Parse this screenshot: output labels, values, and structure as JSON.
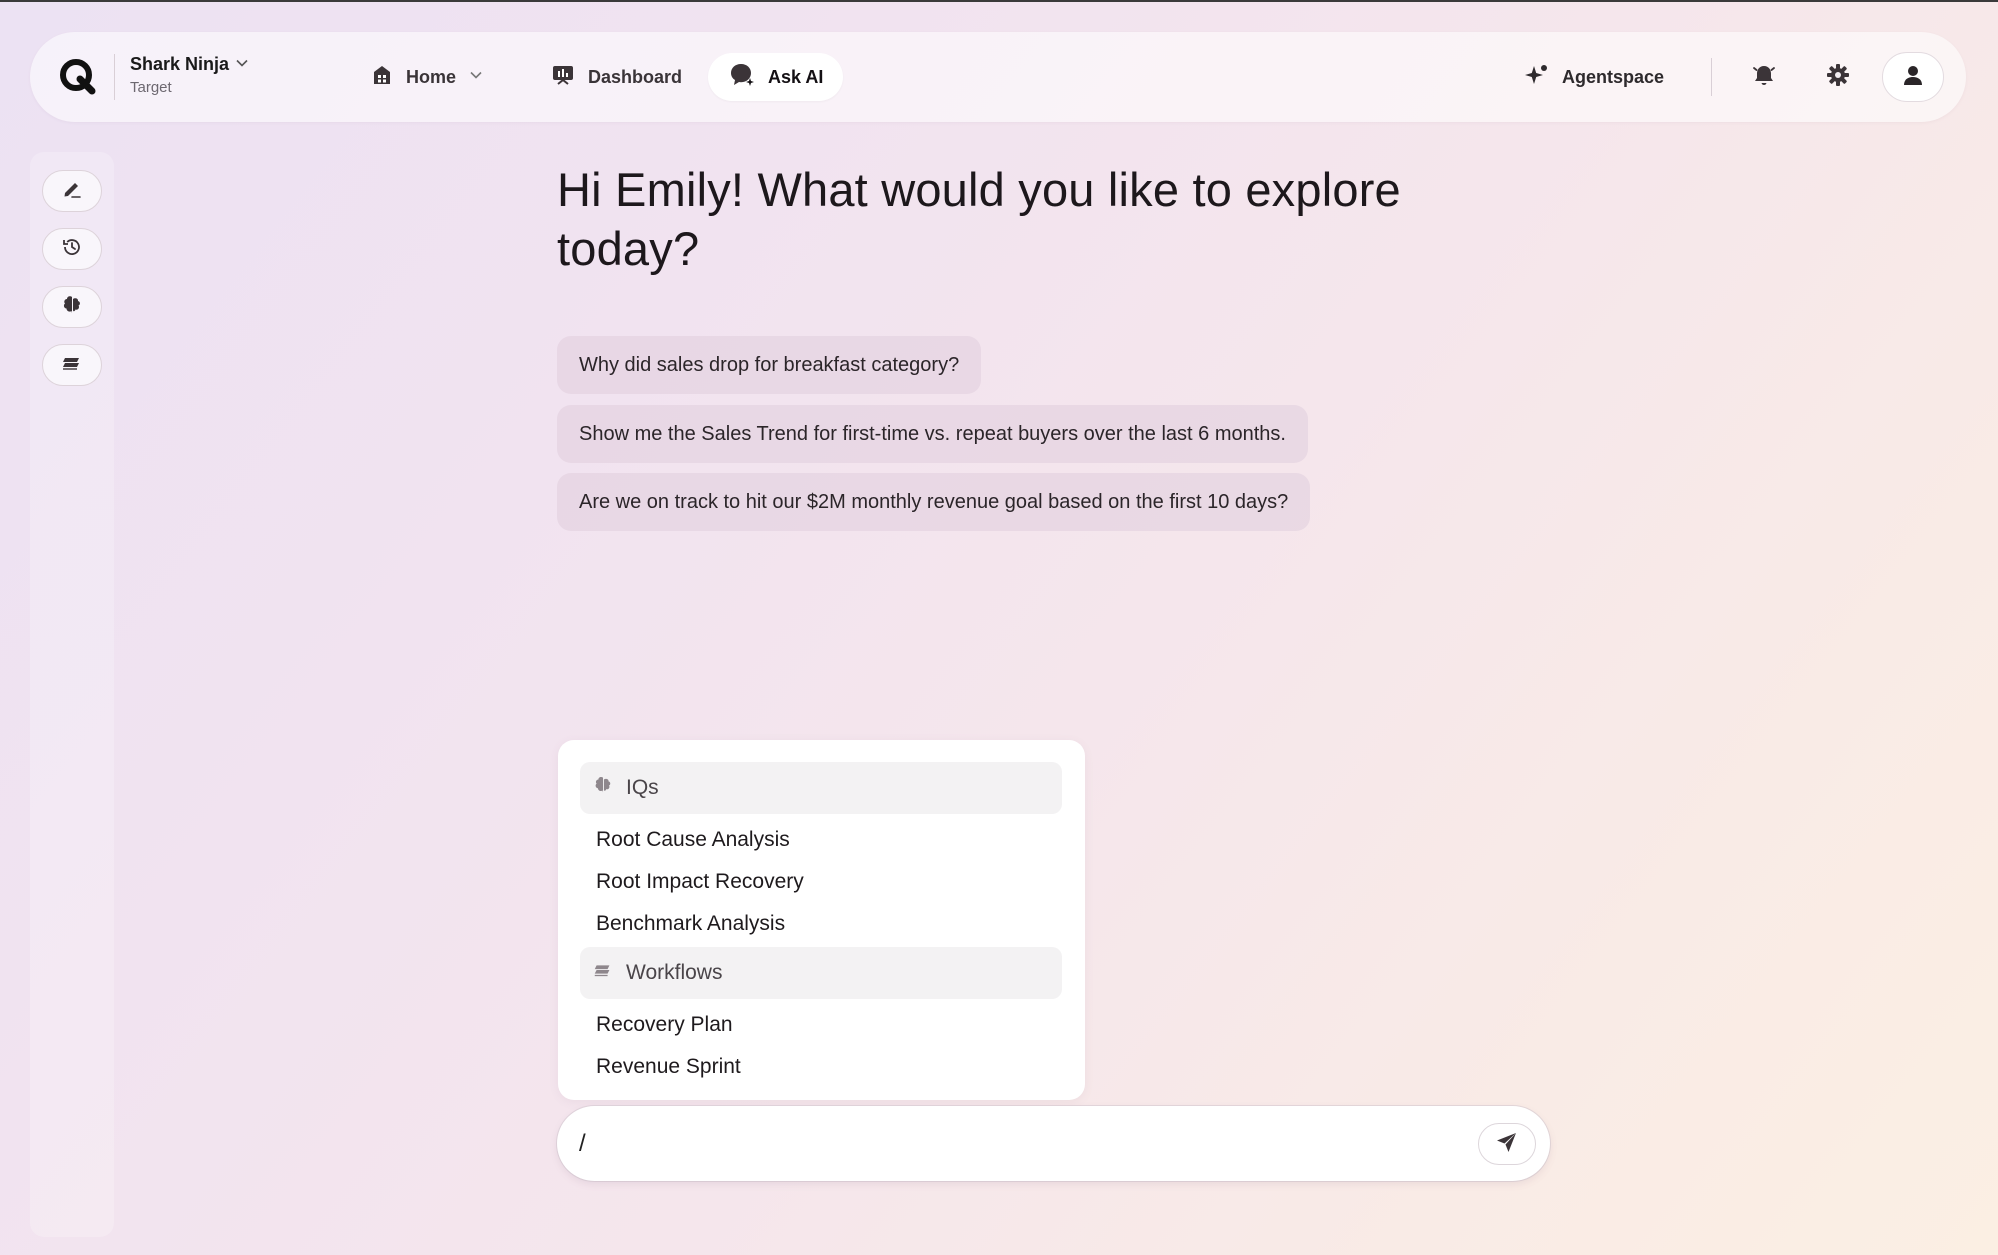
{
  "nav": {
    "workspace_name": "Shark Ninja",
    "workspace_sub": "Target",
    "home_label": "Home",
    "dashboard_label": "Dashboard",
    "askai_label": "Ask AI",
    "agentspace_label": "Agentspace"
  },
  "sidebar": {
    "items": [
      {
        "icon": "new-chat-icon"
      },
      {
        "icon": "history-icon"
      },
      {
        "icon": "iqs-icon"
      },
      {
        "icon": "workflows-icon"
      }
    ]
  },
  "main": {
    "greeting": "Hi Emily! What would you like to explore today?",
    "suggestions": [
      "Why did sales drop for breakfast category?",
      "Show me the Sales Trend for first-time vs. repeat buyers over the last 6 months.",
      "Are we on track to hit our $2M monthly revenue goal based on the first 10 days?"
    ]
  },
  "command_menu": {
    "sections": [
      {
        "title": "IQs",
        "items": [
          "Root Cause Analysis",
          "Root Impact Recovery",
          "Benchmark Analysis"
        ]
      },
      {
        "title": "Workflows",
        "items": [
          "Recovery Plan",
          "Revenue Sprint"
        ]
      }
    ]
  },
  "composer": {
    "value": "/"
  },
  "colors": {
    "accent_dark": "#1d181c",
    "suggestion_bg": "#e2d0de",
    "page_gradient_start": "#ece2f3",
    "page_gradient_end": "#fbefe3"
  }
}
